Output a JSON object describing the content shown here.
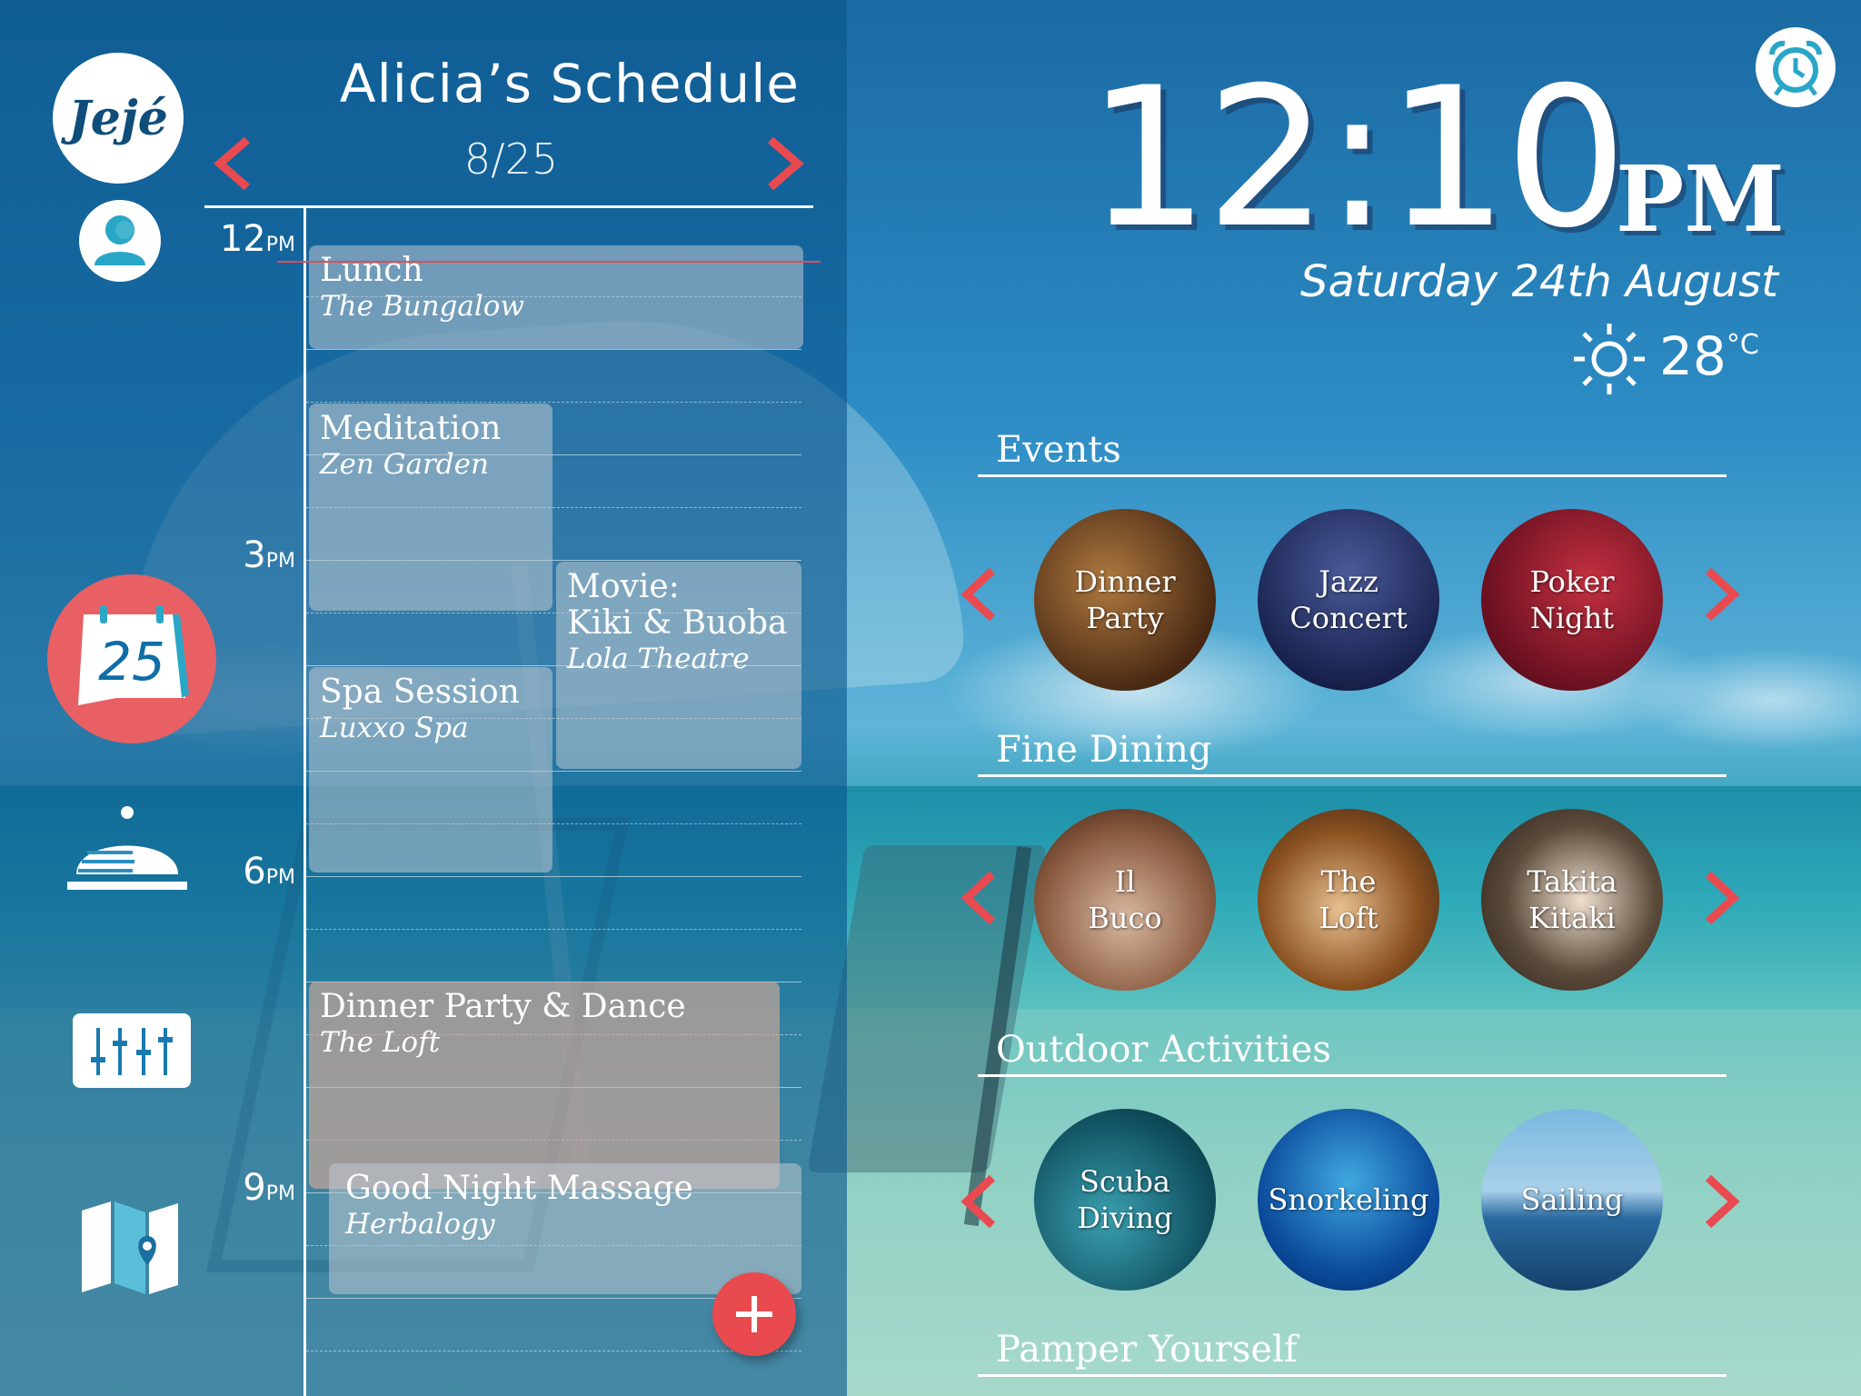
{
  "app": {
    "logo_text": "Jejé"
  },
  "schedule": {
    "title": "Alicia’s Schedule",
    "date": "8/25",
    "times": [
      {
        "hour": "12",
        "suffix": "PM"
      },
      {
        "hour": "3",
        "suffix": "PM"
      },
      {
        "hour": "6",
        "suffix": "PM"
      },
      {
        "hour": "9",
        "suffix": "PM"
      }
    ],
    "events": [
      {
        "title": "Lunch",
        "place": "The Bungalow"
      },
      {
        "title": "Meditation",
        "place": "Zen Garden"
      },
      {
        "title": "Movie:",
        "title2": "Kiki & Buoba",
        "place": "Lola Theatre"
      },
      {
        "title": "Spa Session",
        "place": "Luxxo Spa"
      },
      {
        "title": "Dinner Party & Dance",
        "place": "The Loft"
      },
      {
        "title": "Good Night Massage",
        "place": "Herbalogy"
      }
    ]
  },
  "sidebar": {
    "calendar_day": "25"
  },
  "clock": {
    "time": "12:10",
    "ampm": "PM",
    "date": "Saturday 24th August",
    "temperature": "28",
    "unit": "°C"
  },
  "sections": [
    {
      "title": "Events",
      "items": [
        {
          "line1": "Dinner",
          "line2": "Party"
        },
        {
          "line1": "Jazz",
          "line2": "Concert"
        },
        {
          "line1": "Poker",
          "line2": "Night"
        }
      ]
    },
    {
      "title": "Fine Dining",
      "items": [
        {
          "line1": "Il",
          "line2": "Buco"
        },
        {
          "line1": "The",
          "line2": "Loft"
        },
        {
          "line1": "Takita",
          "line2": "Kitaki"
        }
      ]
    },
    {
      "title": "Outdoor Activities",
      "items": [
        {
          "line1": "Scuba",
          "line2": "Diving"
        },
        {
          "line1": "Snorkeling",
          "line2": ""
        },
        {
          "line1": "Sailing",
          "line2": ""
        }
      ]
    },
    {
      "title": "Pamper Yourself",
      "items": []
    }
  ],
  "colors": {
    "accent": "#e94a4f",
    "panel": "#09558c"
  }
}
